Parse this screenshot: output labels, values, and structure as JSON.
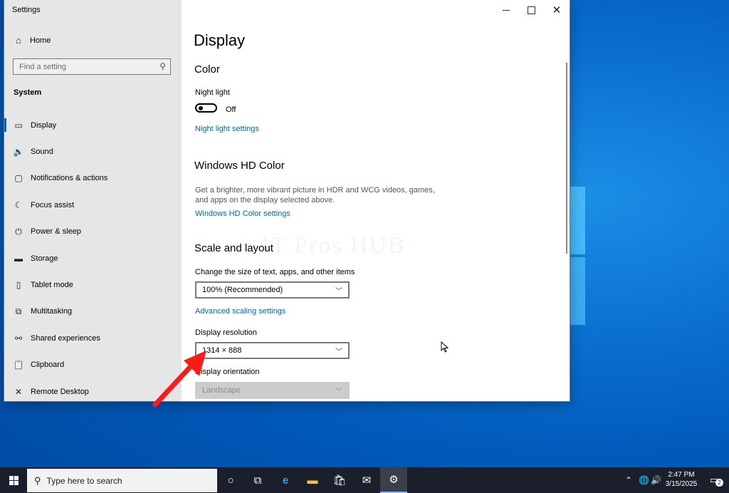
{
  "window": {
    "app_title": "Settings",
    "minimize_glyph": "—",
    "close_glyph": "✕"
  },
  "sidebar": {
    "home_label": "Home",
    "search_placeholder": "Find a setting",
    "section_title": "System",
    "items": [
      {
        "label": "Display",
        "icon": "monitor-icon",
        "glyph": "▭",
        "active": true
      },
      {
        "label": "Sound",
        "icon": "speaker-icon",
        "glyph": "🔈"
      },
      {
        "label": "Notifications & actions",
        "icon": "notifications-icon",
        "glyph": "▢"
      },
      {
        "label": "Focus assist",
        "icon": "moon-icon",
        "glyph": "☾"
      },
      {
        "label": "Power & sleep",
        "icon": "power-icon",
        "glyph": "⏻"
      },
      {
        "label": "Storage",
        "icon": "storage-icon",
        "glyph": "▬"
      },
      {
        "label": "Tablet mode",
        "icon": "tablet-icon",
        "glyph": "▯"
      },
      {
        "label": "Multitasking",
        "icon": "multitasking-icon",
        "glyph": "⧉"
      },
      {
        "label": "Shared experiences",
        "icon": "shared-experiences-icon",
        "glyph": "⚯"
      },
      {
        "label": "Clipboard",
        "icon": "clipboard-icon",
        "glyph": "📋"
      },
      {
        "label": "Remote Desktop",
        "icon": "remote-desktop-icon",
        "glyph": "✕"
      }
    ]
  },
  "main": {
    "page_title": "Display",
    "color": {
      "heading": "Color",
      "night_light_label": "Night light",
      "night_light_state": "Off",
      "night_light_on": false,
      "night_light_settings_link": "Night light settings"
    },
    "hd_color": {
      "heading": "Windows HD Color",
      "description": "Get a brighter, more vibrant picture in HDR and WCG videos, games, and apps on the display selected above.",
      "settings_link": "Windows HD Color settings"
    },
    "scale_layout": {
      "heading": "Scale and layout",
      "scale_label": "Change the size of text, apps, and other items",
      "scale_value": "100% (Recommended)",
      "advanced_link": "Advanced scaling settings",
      "resolution_label": "Display resolution",
      "resolution_value": "1314 × 888",
      "orientation_label": "Display orientation",
      "orientation_value": "Landscape"
    },
    "watermark": "IT Pros HUB"
  },
  "taskbar": {
    "search_placeholder": "Type here to search",
    "time": "2:47 PM",
    "date": "3/15/2025",
    "notification_count": "2"
  },
  "colors": {
    "accent": "#0067c0",
    "link": "#0067b8",
    "sidebar_bg": "#e6e6e6",
    "taskbar_bg": "#1a1f2b",
    "annotation_arrow": "#ff1a1a"
  }
}
